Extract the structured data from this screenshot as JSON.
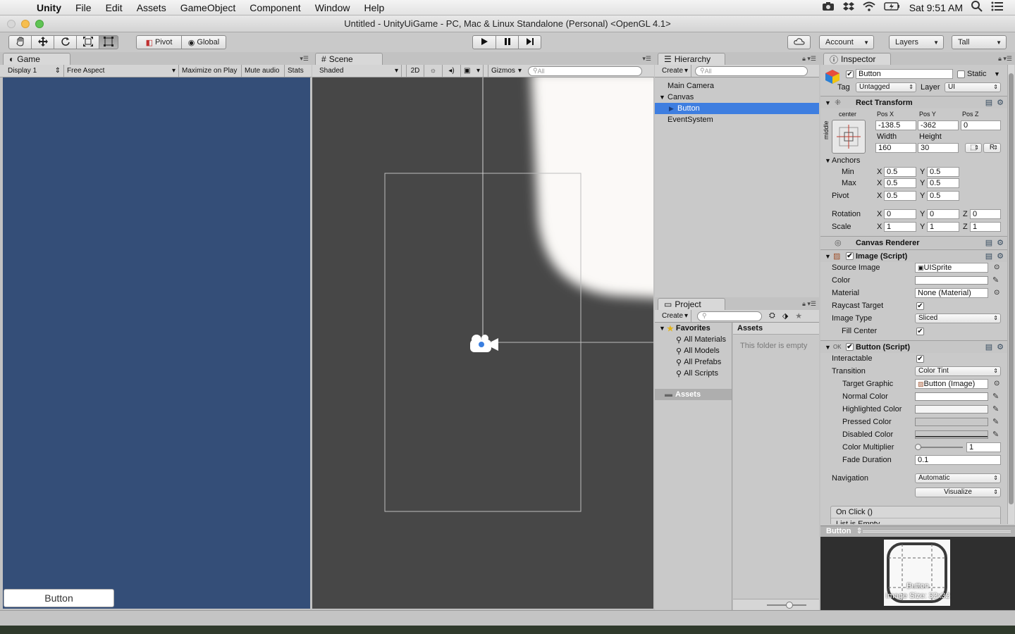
{
  "menubar": {
    "app": "Unity",
    "items": [
      "File",
      "Edit",
      "Assets",
      "GameObject",
      "Component",
      "Window",
      "Help"
    ],
    "clock": "Sat 9:51 AM"
  },
  "window": {
    "title": "Untitled - UnityUiGame - PC, Mac & Linux Standalone (Personal) <OpenGL 4.1>"
  },
  "toolbar": {
    "pivot": "Pivot",
    "global": "Global",
    "account": "Account",
    "layers": "Layers",
    "layout": "Tall"
  },
  "game": {
    "tab": "Game",
    "display": "Display 1",
    "aspect": "Free Aspect",
    "maximize": "Maximize on Play",
    "mute": "Mute audio",
    "stats": "Stats",
    "button_label": "Button"
  },
  "scene": {
    "tab": "Scene",
    "shading": "Shaded",
    "mode2d": "2D",
    "gizmos": "Gizmos",
    "search_placeholder": "All"
  },
  "hierarchy": {
    "tab": "Hierarchy",
    "create": "Create",
    "search_placeholder": "All",
    "items": [
      "Main Camera",
      "Canvas",
      "Button",
      "EventSystem"
    ]
  },
  "project": {
    "tab": "Project",
    "create": "Create",
    "favorites": "Favorites",
    "fav_items": [
      "All Materials",
      "All Models",
      "All Prefabs",
      "All Scripts"
    ],
    "assets": "Assets",
    "assets_header": "Assets",
    "empty_text": "This folder is empty"
  },
  "inspector": {
    "tab": "Inspector",
    "object_name": "Button",
    "static": "Static",
    "tag_label": "Tag",
    "tag": "Untagged",
    "layer_label": "Layer",
    "layer": "UI",
    "rect_transform": {
      "title": "Rect Transform",
      "anchor_h": "center",
      "anchor_v": "middle",
      "posx_label": "Pos X",
      "posx": "-138.5",
      "posy_label": "Pos Y",
      "posy": "-362",
      "posz_label": "Pos Z",
      "posz": "0",
      "width_label": "Width",
      "width": "160",
      "height_label": "Height",
      "height": "30",
      "r_button": "R",
      "anchors": "Anchors",
      "min": "Min",
      "min_x": "0.5",
      "min_y": "0.5",
      "max": "Max",
      "max_x": "0.5",
      "max_y": "0.5",
      "pivot": "Pivot",
      "pivot_x": "0.5",
      "pivot_y": "0.5",
      "rotation": "Rotation",
      "rot_x": "0",
      "rot_y": "0",
      "rot_z": "0",
      "scale": "Scale",
      "scale_x": "1",
      "scale_y": "1",
      "scale_z": "1",
      "x": "X",
      "y": "Y",
      "z": "Z"
    },
    "canvas_renderer": "Canvas Renderer",
    "image": {
      "title": "Image (Script)",
      "source_label": "Source Image",
      "source": "UISprite",
      "color_label": "Color",
      "material_label": "Material",
      "material": "None (Material)",
      "raycast_label": "Raycast Target",
      "type_label": "Image Type",
      "type": "Sliced",
      "fill_label": "Fill Center"
    },
    "button": {
      "title": "Button (Script)",
      "interactable": "Interactable",
      "transition_label": "Transition",
      "transition": "Color Tint",
      "target_label": "Target Graphic",
      "target": "Button (Image)",
      "normal": "Normal Color",
      "highlighted": "Highlighted Color",
      "pressed": "Pressed Color",
      "disabled": "Disabled Color",
      "multiplier_label": "Color Multiplier",
      "multiplier": "1",
      "fade_label": "Fade Duration",
      "fade": "0.1",
      "navigation_label": "Navigation",
      "navigation": "Automatic",
      "visualize": "Visualize",
      "onclick": "On Click ()",
      "list_empty": "List is Empty"
    },
    "preview": {
      "title": "Button",
      "label": "Button",
      "size": "Image Size: 32x32"
    }
  },
  "colors": {
    "game_bg": "#344e78",
    "scene_bg": "#474747",
    "selection": "#3e7ee0"
  }
}
